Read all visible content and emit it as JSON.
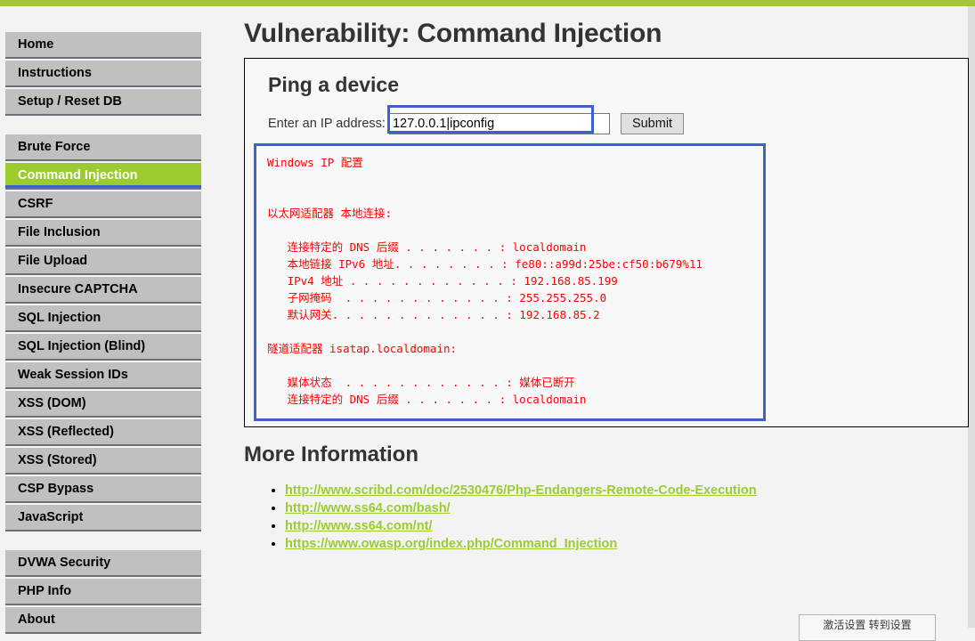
{
  "theme": {
    "accent_green": "#a4c639",
    "selected_green": "#9bcb2f",
    "focus_blue": "#3c62d0",
    "output_red": "#ff0000",
    "nav_gray": "#c0c0c0",
    "link_green": "#9acd32"
  },
  "page_title": "Vulnerability: Command Injection",
  "sidebar": {
    "groups": [
      {
        "items": [
          {
            "label": "Home",
            "selected": false
          },
          {
            "label": "Instructions",
            "selected": false
          },
          {
            "label": "Setup / Reset DB",
            "selected": false
          }
        ]
      },
      {
        "items": [
          {
            "label": "Brute Force",
            "selected": false
          },
          {
            "label": "Command Injection",
            "selected": true
          },
          {
            "label": "CSRF",
            "selected": false
          },
          {
            "label": "File Inclusion",
            "selected": false
          },
          {
            "label": "File Upload",
            "selected": false
          },
          {
            "label": "Insecure CAPTCHA",
            "selected": false
          },
          {
            "label": "SQL Injection",
            "selected": false
          },
          {
            "label": "SQL Injection (Blind)",
            "selected": false
          },
          {
            "label": "Weak Session IDs",
            "selected": false
          },
          {
            "label": "XSS (DOM)",
            "selected": false
          },
          {
            "label": "XSS (Reflected)",
            "selected": false
          },
          {
            "label": "XSS (Stored)",
            "selected": false
          },
          {
            "label": "CSP Bypass",
            "selected": false
          },
          {
            "label": "JavaScript",
            "selected": false
          }
        ]
      },
      {
        "items": [
          {
            "label": "DVWA Security",
            "selected": false
          },
          {
            "label": "PHP Info",
            "selected": false
          },
          {
            "label": "About",
            "selected": false
          }
        ]
      }
    ]
  },
  "vulnerability": {
    "section_title": "Ping a device",
    "form": {
      "ip_label": "Enter an IP address:",
      "ip_value": "127.0.0.1|ipconfig",
      "ip_placeholder": "",
      "submit_label": "Submit"
    },
    "command_output": "Windows IP 配置\n\n\n以太网适配器 本地连接:\n\n   连接特定的 DNS 后缀 . . . . . . . : localdomain\n   本地链接 IPv6 地址. . . . . . . . : fe80::a99d:25be:cf50:b679%11\n   IPv4 地址 . . . . . . . . . . . . : 192.168.85.199\n   子网掩码  . . . . . . . . . . . . : 255.255.255.0\n   默认网关. . . . . . . . . . . . . : 192.168.85.2\n\n隧道适配器 isatap.localdomain:\n\n   媒体状态  . . . . . . . . . . . . : 媒体已断开\n   连接特定的 DNS 后缀 . . . . . . . : localdomain\n"
  },
  "more_information": {
    "heading": "More Information",
    "links": [
      "http://www.scribd.com/doc/2530476/Php-Endangers-Remote-Code-Execution",
      "http://www.ss64.com/bash/",
      "http://www.ss64.com/nt/",
      "https://www.owasp.org/index.php/Command_Injection"
    ]
  },
  "activation_watermark": {
    "text": "激活设置    转到设置"
  }
}
